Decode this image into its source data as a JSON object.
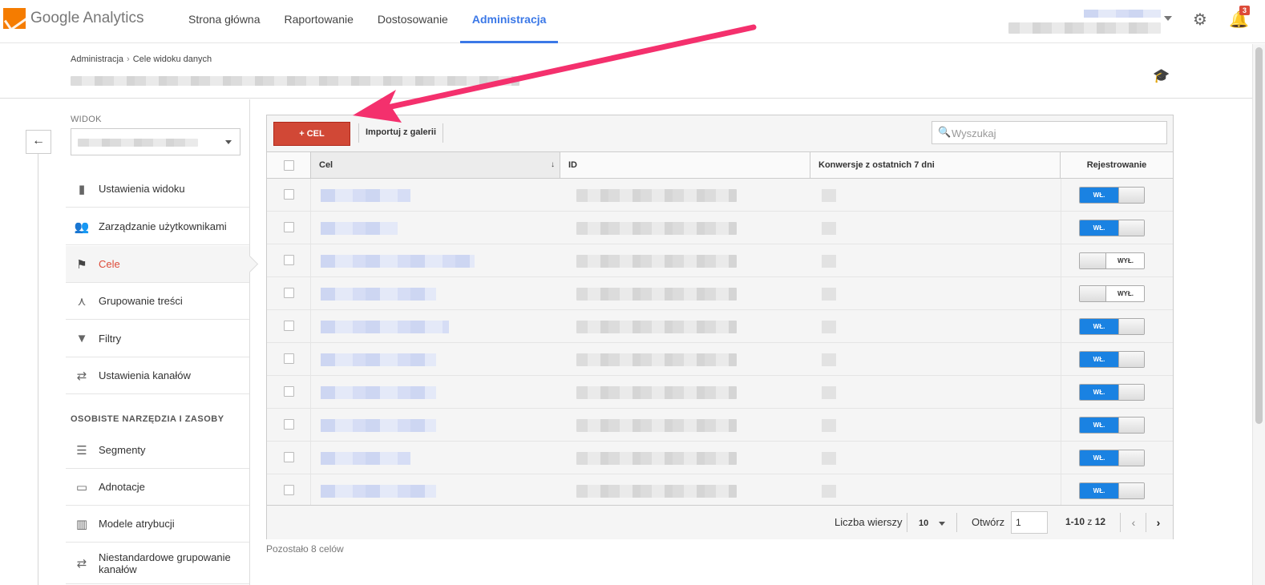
{
  "header": {
    "logo_text": "Google Analytics",
    "nav": [
      {
        "label": "Strona główna",
        "active": false
      },
      {
        "label": "Raportowanie",
        "active": false
      },
      {
        "label": "Dostosowanie",
        "active": false
      },
      {
        "label": "Administracja",
        "active": true
      }
    ],
    "notifications_count": "3",
    "icons": {
      "settings": "gear-icon",
      "notifications": "bell-icon"
    }
  },
  "breadcrumb": {
    "root": "Administracja",
    "separator": "›",
    "current": "Cele widoku danych"
  },
  "sidebar": {
    "view_label": "WIDOK",
    "items": [
      {
        "label": "Ustawienia widoku",
        "icon": "document-icon",
        "active": false
      },
      {
        "label": "Zarządzanie użytkownikami",
        "icon": "users-icon",
        "active": false
      },
      {
        "label": "Cele",
        "icon": "flag-icon",
        "active": true
      },
      {
        "label": "Grupowanie treści",
        "icon": "content-grouping-icon",
        "active": false
      },
      {
        "label": "Filtry",
        "icon": "filter-icon",
        "active": false
      },
      {
        "label": "Ustawienia kanałów",
        "icon": "channel-settings-icon",
        "active": false
      }
    ],
    "section_title": "OSOBISTE NARZĘDZIA I ZASOBY",
    "personal_items": [
      {
        "label": "Segmenty",
        "icon": "segments-icon"
      },
      {
        "label": "Adnotacje",
        "icon": "annotations-icon"
      },
      {
        "label": "Modele atrybucji",
        "icon": "attribution-models-icon"
      },
      {
        "label": "Niestandardowe grupowanie kanałów",
        "icon": "custom-channel-grouping-icon"
      }
    ]
  },
  "toolbar": {
    "new_goal_label": "+ CEL",
    "import_label": "Importuj z galerii",
    "search_placeholder": "Wyszukaj"
  },
  "table": {
    "columns": [
      "Cel",
      "ID",
      "Konwersje z ostatnich 7 dni",
      "Rejestrowanie"
    ],
    "sort_indicator": "↓",
    "on_label": "WŁ.",
    "off_label": "WYŁ.",
    "rows": [
      {
        "recording": true
      },
      {
        "recording": true
      },
      {
        "recording": false
      },
      {
        "recording": false
      },
      {
        "recording": true
      },
      {
        "recording": true
      },
      {
        "recording": true
      },
      {
        "recording": true
      },
      {
        "recording": true
      },
      {
        "recording": true
      }
    ]
  },
  "pagination": {
    "rows_label": "Liczba wierszy",
    "rows_value": "10",
    "open_label": "Otwórz",
    "open_value": "1",
    "range": "1-10",
    "of_label": "z",
    "total": "12"
  },
  "remaining_text": "Pozostało 8 celów",
  "colors": {
    "accent": "#3b78e7",
    "primary_button": "#d14836",
    "toggle_on": "#1a82e2",
    "annotation_arrow": "#f4306d"
  }
}
